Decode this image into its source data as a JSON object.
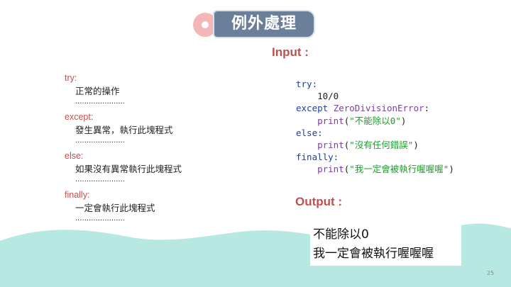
{
  "title": "例外處理",
  "headers": {
    "input": "Input :",
    "output": "Output :"
  },
  "syntax": [
    {
      "kw": "try:",
      "line": "正常的操作",
      "dots": "......................"
    },
    {
      "kw": "except:",
      "line": "發生異常，執行此塊程式",
      "dots": "......................"
    },
    {
      "kw": "else:",
      "line": "如果沒有異常執行此塊程式",
      "dots": "......................"
    },
    {
      "kw": "finally:",
      "line": "一定會執行此塊程式",
      "dots": "......................"
    }
  ],
  "code": {
    "try_kw": "try:",
    "num_expr": "10/0",
    "except_kw": "except",
    "exc_name": "ZeroDivisionError",
    "colon": ":",
    "print1_fn": "print",
    "print1_str": "\"不能除以0\"",
    "else_kw": "else:",
    "print2_fn": "print",
    "print2_str": "\"沒有任何錯誤\"",
    "finally_kw": "finally:",
    "print3_fn": "print",
    "print3_str": "\"我一定會被執行喔喔喔\"",
    "open_paren": "(",
    "close_paren": ")"
  },
  "output_lines": [
    "不能除以0",
    "我一定會被執行喔喔喔"
  ],
  "page_number": "25",
  "colors": {
    "accent": "#c0504d",
    "title_bg": "#6b7f9a",
    "wave": "#b7e8e2",
    "keyword": "#1e3ea0",
    "string": "#1b9e2a",
    "function": "#7b3fa0"
  }
}
